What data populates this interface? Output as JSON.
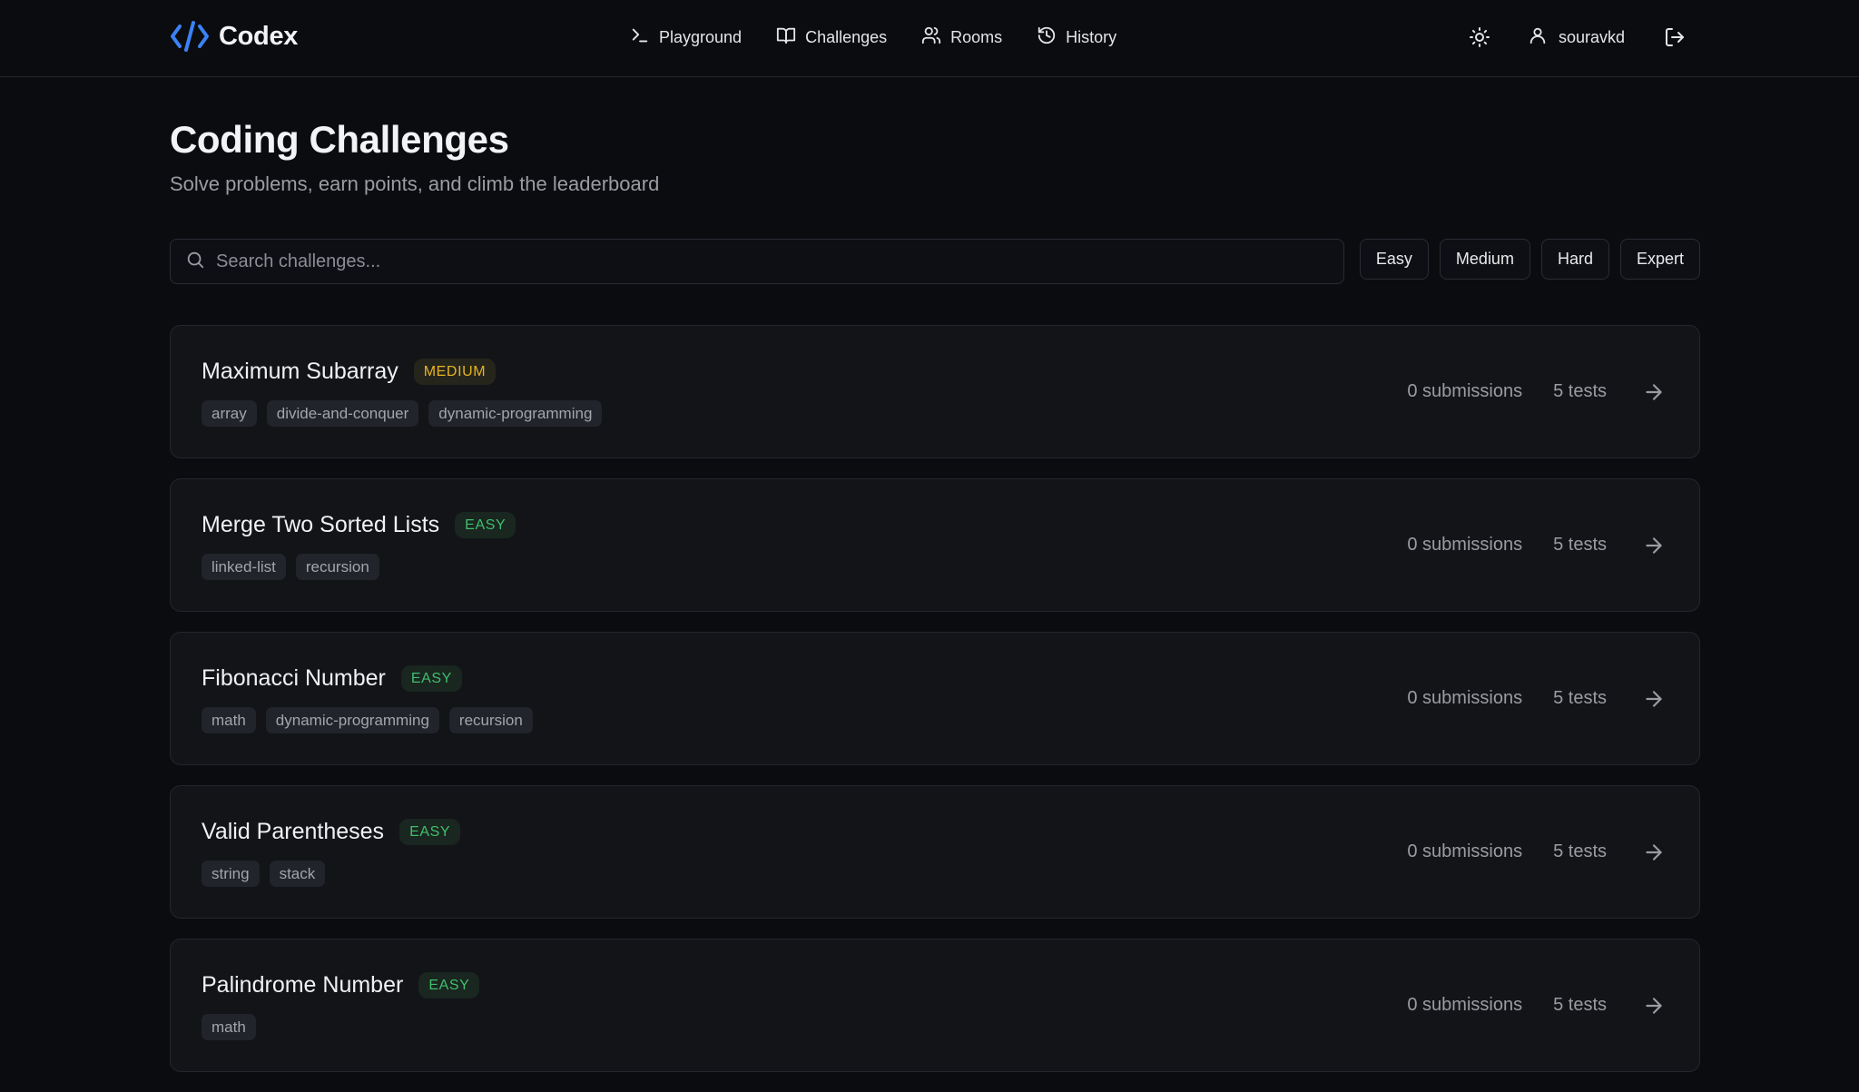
{
  "brand": {
    "name": "Codex",
    "accent": "#3b82f6"
  },
  "nav": [
    {
      "label": "Playground",
      "icon": "terminal-icon"
    },
    {
      "label": "Challenges",
      "icon": "book-open-icon"
    },
    {
      "label": "Rooms",
      "icon": "users-icon"
    },
    {
      "label": "History",
      "icon": "history-icon"
    }
  ],
  "user": {
    "username": "souravkd"
  },
  "page": {
    "title": "Coding Challenges",
    "subtitle": "Solve problems, earn points, and climb the leaderboard"
  },
  "search": {
    "placeholder": "Search challenges...",
    "value": ""
  },
  "filters": [
    "Easy",
    "Medium",
    "Hard",
    "Expert"
  ],
  "difficulty_colors": {
    "EASY": "#3fbf6c",
    "MEDIUM": "#e6b323"
  },
  "challenges": [
    {
      "title": "Maximum Subarray",
      "difficulty": "MEDIUM",
      "tags": [
        "array",
        "divide-and-conquer",
        "dynamic-programming"
      ],
      "submissions": "0 submissions",
      "tests": "5 tests"
    },
    {
      "title": "Merge Two Sorted Lists",
      "difficulty": "EASY",
      "tags": [
        "linked-list",
        "recursion"
      ],
      "submissions": "0 submissions",
      "tests": "5 tests"
    },
    {
      "title": "Fibonacci Number",
      "difficulty": "EASY",
      "tags": [
        "math",
        "dynamic-programming",
        "recursion"
      ],
      "submissions": "0 submissions",
      "tests": "5 tests"
    },
    {
      "title": "Valid Parentheses",
      "difficulty": "EASY",
      "tags": [
        "string",
        "stack"
      ],
      "submissions": "0 submissions",
      "tests": "5 tests"
    },
    {
      "title": "Palindrome Number",
      "difficulty": "EASY",
      "tags": [
        "math"
      ],
      "submissions": "0 submissions",
      "tests": "5 tests"
    }
  ]
}
